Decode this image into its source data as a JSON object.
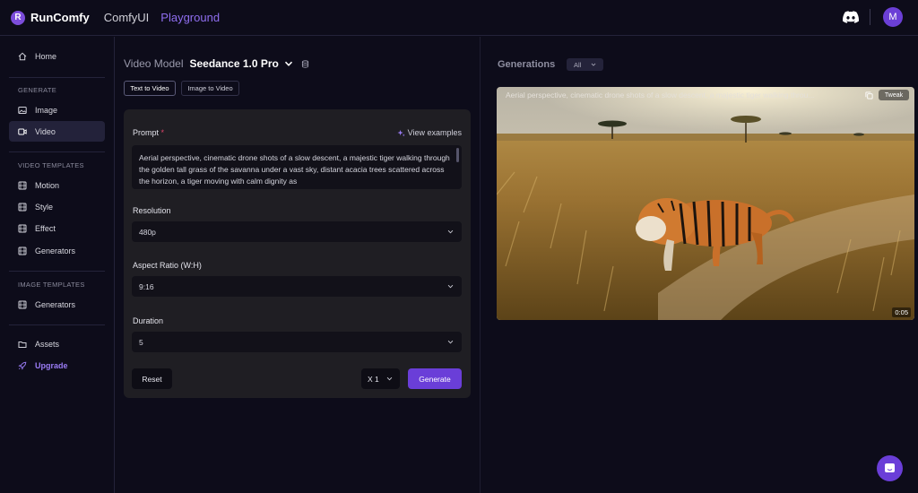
{
  "header": {
    "logo_letter": "R",
    "brand": "RunComfy",
    "nav": [
      "ComfyUI",
      "Playground"
    ],
    "active_nav": "Playground",
    "avatar_initial": "M",
    "icons": [
      "discord-icon"
    ]
  },
  "sidebar": {
    "home": "Home",
    "sections": {
      "generate": "GENERATE",
      "video_templates": "VIDEO TEMPLATES",
      "image_templates": "IMAGE TEMPLATES"
    },
    "generate_items": [
      "Image",
      "Video"
    ],
    "video_template_items": [
      "Motion",
      "Style",
      "Effect",
      "Generators"
    ],
    "image_template_items": [
      "Generators"
    ],
    "assets": "Assets",
    "upgrade": "Upgrade",
    "active_item": "Video"
  },
  "form": {
    "model_label": "Video Model",
    "model_name": "Seedance 1.0 Pro",
    "tabs": [
      "Text to Video",
      "Image to Video"
    ],
    "active_tab": "Text to Video",
    "prompt_label": "Prompt",
    "required_marker": "*",
    "view_examples": "View examples",
    "prompt_text": "Aerial perspective, cinematic drone shots of a slow descent, a majestic tiger walking through the golden tall grass of the savanna under a vast sky, distant acacia trees scattered across the horizon, a tiger moving with calm dignity as",
    "resolution_label": "Resolution",
    "resolution_value": "480p",
    "aspect_label": "Aspect Ratio (W:H)",
    "aspect_value": "9:16",
    "duration_label": "Duration",
    "duration_value": "5",
    "reset": "Reset",
    "count": "X 1",
    "generate": "Generate"
  },
  "generations": {
    "title": "Generations",
    "filter": "All",
    "items": [
      {
        "prompt": "Aerial perspective, cinematic drone shots of a slow descent, a majestic tiger walking throu...",
        "tweak": "Tweak",
        "duration": "0:05"
      }
    ]
  },
  "colors": {
    "accent": "#6a3ed8",
    "accent_text": "#8f6ef0",
    "background": "#0d0c1a",
    "card": "#1f1e23"
  }
}
